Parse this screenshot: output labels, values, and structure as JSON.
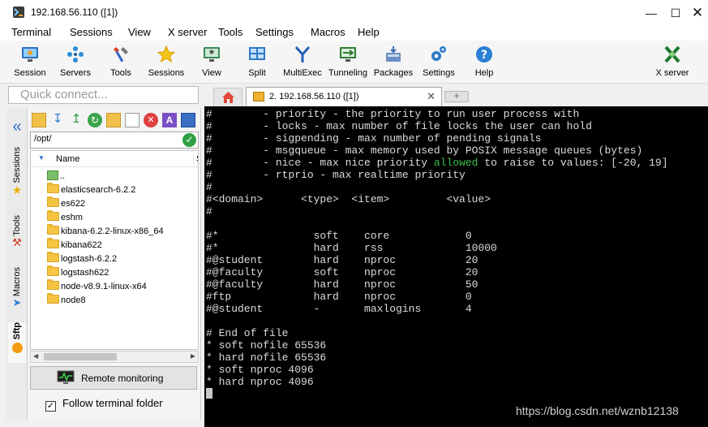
{
  "window": {
    "title": "192.168.56.110 ([1])"
  },
  "menu": [
    "Terminal",
    "Sessions",
    "View",
    "X server",
    "Tools",
    "Settings",
    "Macros",
    "Help"
  ],
  "toolbar": {
    "session": "Session",
    "servers": "Servers",
    "tools": "Tools",
    "sessions": "Sessions",
    "view": "View",
    "split": "Split",
    "multiexec": "MultiExec",
    "tunneling": "Tunneling",
    "packages": "Packages",
    "settings": "Settings",
    "help": "Help",
    "xserver": "X server"
  },
  "quick_connect": {
    "placeholder": "Quick connect..."
  },
  "side_tabs": {
    "sessions": "Sessions",
    "tools": "Tools",
    "macros": "Macros",
    "sftp": "Sftp"
  },
  "sftp": {
    "path": "/opt/",
    "column_name": "Name",
    "column_size": "S",
    "parent": "..",
    "items": [
      "elasticsearch-6.2.2",
      "es622",
      "eshm",
      "kibana-6.2.2-linux-x86_64",
      "kibana622",
      "logstash-6.2.2",
      "logstash622",
      "node-v8.9.1-linux-x64",
      "node8"
    ],
    "remote_monitoring": "Remote monitoring",
    "follow_folder": "Follow terminal folder",
    "follow_checked": true
  },
  "tabs": {
    "session_tab": "2. 192.168.56.110 ([1])"
  },
  "terminal": {
    "lines": [
      "#        - priority - the priority to run user process with",
      "#        - locks - max number of file locks the user can hold",
      "#        - sigpending - max number of pending signals",
      "#        - msgqueue - max memory used by POSIX message queues (bytes)",
      "#        - nice - max nice priority |allowed| to raise to values: [-20, 19]",
      "#        - rtprio - max realtime priority",
      "#",
      "#<domain>      <type>  <item>         <value>",
      "#",
      "",
      "#*               soft    core            0",
      "#*               hard    rss             10000",
      "#@student        hard    nproc           20",
      "#@faculty        soft    nproc           20",
      "#@faculty        hard    nproc           50",
      "#ftp             hard    nproc           0",
      "#@student        -       maxlogins       4",
      "",
      "# End of file",
      "* soft nofile 65536",
      "* hard nofile 65536",
      "* soft nproc 4096",
      "* hard nproc 4096"
    ]
  },
  "watermark": "https://blog.csdn.net/wznb12138",
  "colors": {
    "terminal_bg": "#000000",
    "terminal_fg": "#dcdcdc",
    "highlight": "#39c24b",
    "folder": "#f6c443"
  }
}
